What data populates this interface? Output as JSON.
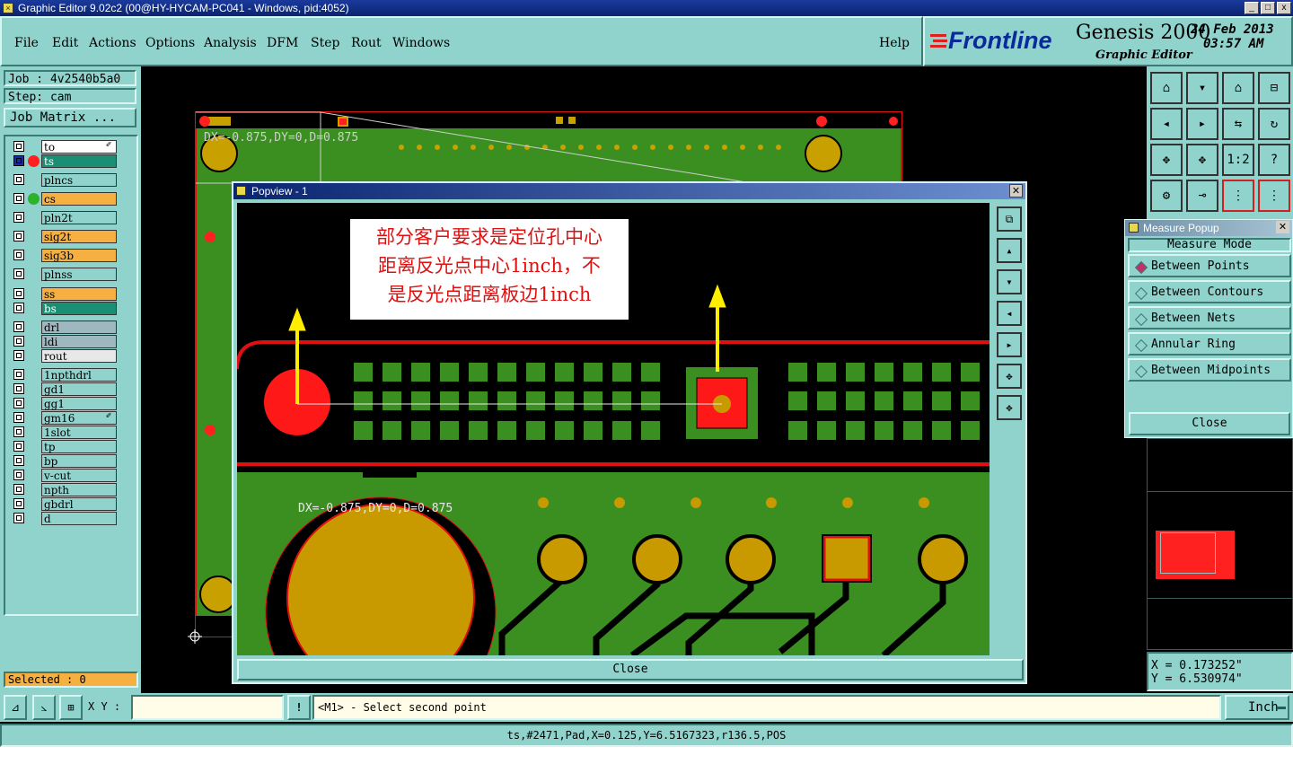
{
  "window": {
    "title": "Graphic Editor 9.02c2 (00@HY-HYCAM-PC041 - Windows, pid:4052)",
    "min": "_",
    "max": "□",
    "close": "x"
  },
  "menu": {
    "file": "File",
    "edit": "Edit",
    "actions": "Actions",
    "options": "Options",
    "analysis": "Analysis",
    "dfm": "DFM",
    "step": "Step",
    "rout": "Rout",
    "windows": "Windows",
    "help": "Help"
  },
  "brand": {
    "logo": "Frontline",
    "product": "Genesis 2000",
    "subtitle": "Graphic Editor",
    "date": "24 Feb 2013",
    "time": "03:57 AM"
  },
  "job": {
    "job": "Job : 4v2540b5a0",
    "step": "Step: cam",
    "matrix_button": "Job Matrix ..."
  },
  "layers": [
    "to",
    "ts",
    "plncs",
    "pln2t",
    "cs",
    "sig2t",
    "sig3b",
    "plnss",
    "ss",
    "bs",
    "drl",
    "ldi",
    "rout",
    "1npthdrl",
    "gd1",
    "gg1",
    "gm16",
    "1slot",
    "tp",
    "bp",
    "v-cut",
    "npth",
    "gbdrl",
    "d"
  ],
  "selected": "Selected : 0",
  "canvas": {
    "dx_label": "DX=-0.875,DY=0,D=0.875"
  },
  "popview": {
    "title": "Popview - 1",
    "annotation_lines": [
      "部分客户要求是定位孔中心",
      "距离反光点中心1inch，不",
      "是反光点距离板边1inch"
    ],
    "dx_label": "DX=-0.875,DY=0,D=0.875",
    "close": "Close"
  },
  "measure": {
    "title": "Measure Popup",
    "mode_label": "Measure Mode",
    "modes": [
      "Between Points",
      "Between Contours",
      "Between Nets",
      "Annular Ring",
      "Between Midpoints"
    ],
    "selected_mode": "Between Points",
    "close": "Close"
  },
  "tools": {
    "ratio": "1:2",
    "help": "?"
  },
  "coords": {
    "x": "X  = 0.173252\"",
    "y": "Y  = 6.530974\""
  },
  "bottom": {
    "xy_label": "X Y :",
    "xy_value": "",
    "prompt": "<M1> - Select second point",
    "units": "Inch"
  },
  "status": "ts,#2471,Pad,X=0.125,Y=6.5167323,r136.5,POS"
}
